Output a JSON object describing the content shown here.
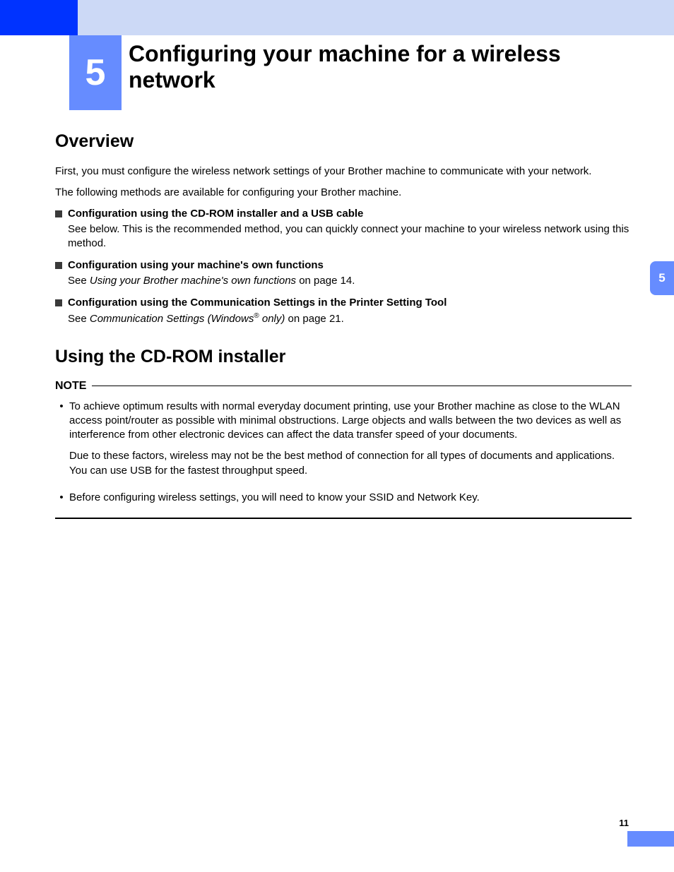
{
  "chapter": {
    "number": "5",
    "title": "Configuring your machine for a wireless network"
  },
  "side_tab": "5",
  "page_number": "11",
  "overview": {
    "heading": "Overview",
    "p1": "First, you must configure the wireless network settings of your Brother machine to communicate with your network.",
    "p2": "The following methods are available for configuring your Brother machine.",
    "items": [
      {
        "title": "Configuration using the CD-ROM installer and a USB cable",
        "body": "See below. This is the recommended method, you can quickly connect your machine to your wireless network using this method."
      },
      {
        "title": "Configuration using your machine's own functions",
        "body_pre": "See ",
        "body_italic": "Using your Brother machine's own functions",
        "body_post": " on page 14."
      },
      {
        "title": "Configuration using the Communication Settings in the Printer Setting Tool",
        "body_pre": "See ",
        "body_italic_a": "Communication Settings (Windows",
        "sup": "®",
        "body_italic_b": " only)",
        "body_post": " on page 21."
      }
    ]
  },
  "cdrom": {
    "heading": "Using the CD-ROM installer",
    "note_label": "NOTE",
    "notes": [
      {
        "p1": "To achieve optimum results with normal everyday document printing, use your Brother machine as close to the WLAN access point/router as possible with minimal obstructions. Large objects and walls between the two devices as well as interference from other electronic devices can affect the data transfer speed of your documents.",
        "p2": "Due to these factors, wireless may not be the best method of connection for all types of documents and applications. You can use USB for the fastest throughput speed."
      },
      {
        "p1": "Before configuring wireless settings, you will need to know your SSID and Network Key."
      }
    ]
  }
}
